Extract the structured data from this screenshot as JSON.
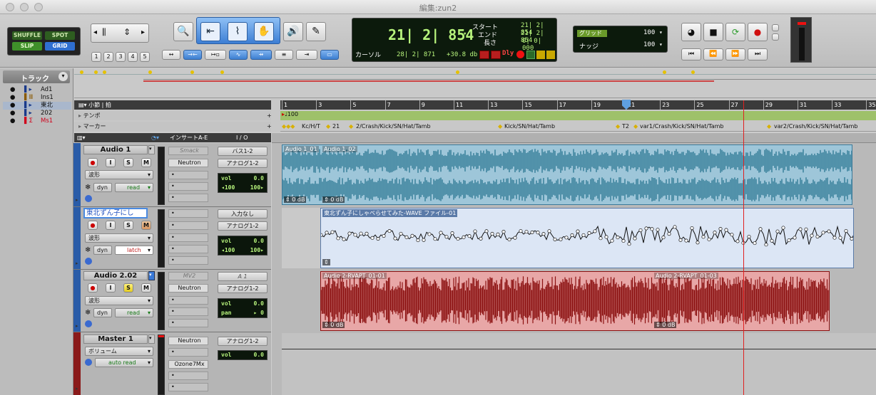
{
  "window": {
    "title": "編集:zun2"
  },
  "edit_modes": {
    "shuffle": "SHUFFLE",
    "spot": "SPOT",
    "slip": "SLIP",
    "grid": "GRID"
  },
  "zoom_presets": [
    "1",
    "2",
    "3",
    "4",
    "5"
  ],
  "counter": {
    "main": "21| 2| 854",
    "start_label": "スタート",
    "end_label": "エンド",
    "length_label": "長さ",
    "start": "21| 2| 854",
    "end": "21| 2| 854",
    "length": "0| 0| 000",
    "cursor_label": "カーソル",
    "cursor": "28| 2| 871",
    "db": "+30.8 db",
    "dly": "Dly"
  },
  "grid": {
    "grid_label": "グリッド",
    "grid_value": "100",
    "nudge_label": "ナッジ",
    "nudge_value": "100"
  },
  "tracks_label": "トラック",
  "track_list": [
    {
      "name": "Ad1",
      "color": "#000"
    },
    {
      "name": "Ins1",
      "color": "#000"
    },
    {
      "name": "東北",
      "color": "#000"
    },
    {
      "name": "202",
      "color": "#000"
    },
    {
      "name": "Ms1",
      "color": "#d0021b"
    }
  ],
  "rulers": {
    "bars": "小節 | 拍",
    "tempo": "テンポ",
    "tempo_value": "100",
    "marker": "マーカー"
  },
  "bar_numbers": [
    "1",
    "3",
    "5",
    "7",
    "9",
    "11",
    "13",
    "15",
    "17",
    "19",
    "21",
    "23",
    "25",
    "27",
    "29",
    "31",
    "33",
    "35"
  ],
  "markers": [
    "Kc/H/T",
    "21",
    "2/Crash/Kick/SN/Hat/Tamb",
    "Kick/SN/Hat/Tamb",
    "T2",
    "var1/Crash/Kick/SN/Hat/Tamb",
    "var2/Crash/Kick/SN/Hat/Tamb"
  ],
  "column_headers": {
    "inserts": "インサートA-E",
    "io": "I / O"
  },
  "tracks": [
    {
      "name": "Audio 1",
      "view": "波形",
      "dyn": "dyn",
      "auto": "read",
      "inserts": [
        "Smack",
        "Neutron"
      ],
      "io_in": "バス1-2",
      "io_out": "アナログ1-2",
      "vol_label": "vol",
      "vol": "0.0",
      "p1": "◂100",
      "p2": "100▸",
      "regions": [
        "Audio 1_01",
        "Audio 1_02"
      ],
      "gain": "0 dB",
      "gain2": "0 dB"
    },
    {
      "name": "東北ずん子にし",
      "view": "波形",
      "dyn": "dyn",
      "auto": "latch",
      "inserts": [],
      "io_in": "入力なし",
      "io_out": "アナログ1-2",
      "vol_label": "vol",
      "vol": "0.0",
      "p1": "◂100",
      "p2": "100▸",
      "regions": [
        "東北ずん子にしゃべらせてみた-WAVE ファイル-01"
      ]
    },
    {
      "name": "Audio 2.02",
      "view": "波形",
      "dyn": "dyn",
      "auto": "read",
      "inserts": [
        "MV2",
        "Neutron"
      ],
      "io_in": "A 1",
      "io_out": "アナログ1-2",
      "vol_label": "vol",
      "vol": "0.0",
      "pan_label": "pan",
      "pan": "▸ 0",
      "regions": [
        "Audio 2-RVAPT_01-01",
        "Audio 2-RVAPT_01-03"
      ],
      "gain": "0 dB",
      "gain2": "0 dB"
    },
    {
      "name": "Master 1",
      "view": "ボリューム",
      "auto": "auto read",
      "inserts": [
        "Neutron",
        "Ozone7Mx"
      ],
      "io_out": "アナログ1-2",
      "vol_label": "vol",
      "vol": "0.0"
    }
  ],
  "colors": {
    "audio1": "#1f6f8b",
    "audio1_bg": "#9ec6d9",
    "zunko_bg": "#dce6f5",
    "audio2": "#8b1010",
    "audio2_bg": "#e8a7a7",
    "playhead": "#e02020",
    "tempo_bar": "#9ec16a"
  }
}
